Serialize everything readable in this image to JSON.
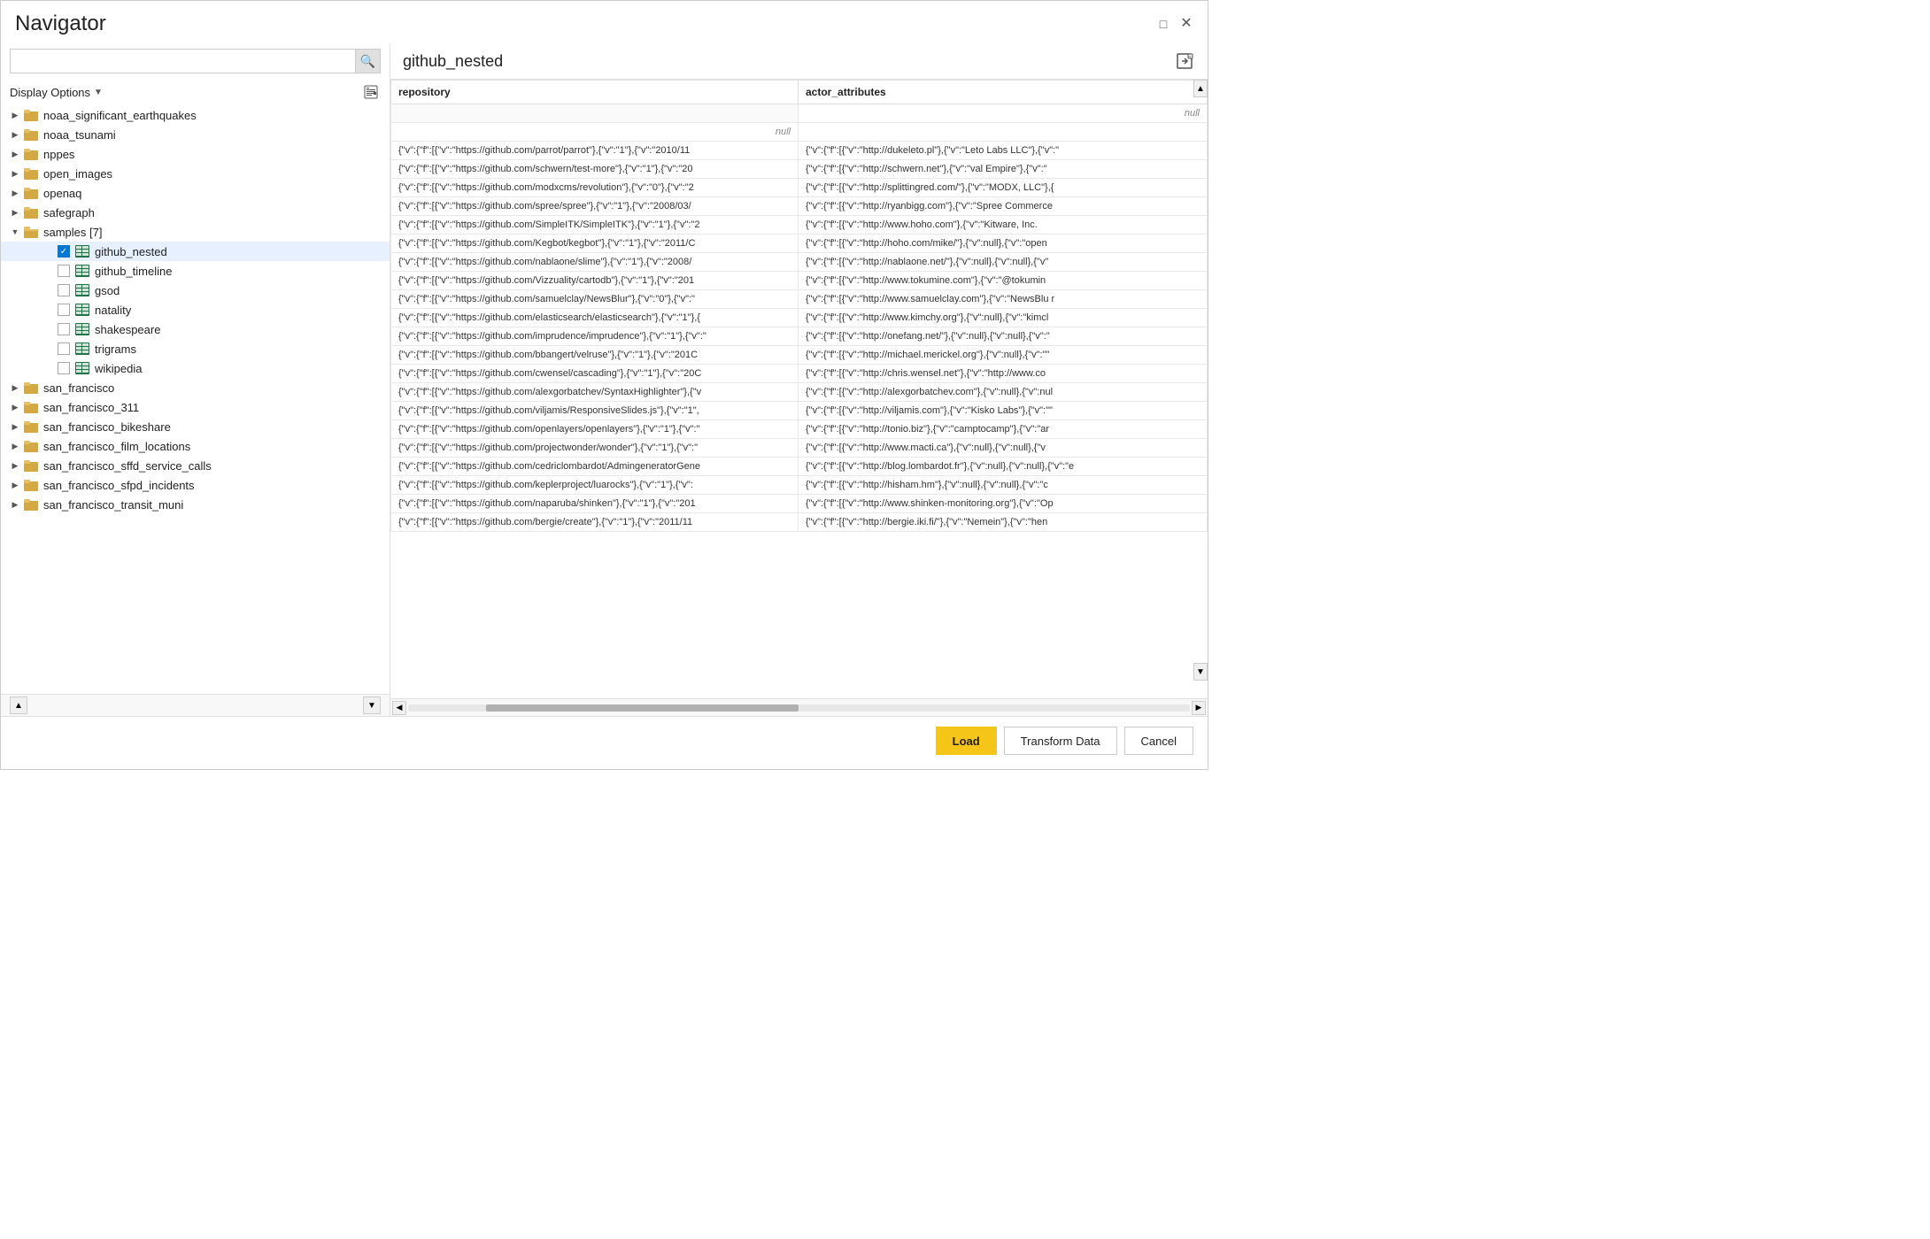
{
  "window": {
    "title": "Navigator"
  },
  "windowControls": {
    "minimize": "🗖",
    "close": "✕"
  },
  "leftPanel": {
    "searchPlaceholder": "",
    "displayOptions": "Display Options",
    "treeItems": [
      {
        "id": "noaa_significant_earthquakes",
        "label": "noaa_significant_earthquakes",
        "level": 1,
        "type": "folder",
        "state": "collapsed"
      },
      {
        "id": "noaa_tsunami",
        "label": "noaa_tsunami",
        "level": 1,
        "type": "folder",
        "state": "collapsed"
      },
      {
        "id": "nppes",
        "label": "nppes",
        "level": 1,
        "type": "folder",
        "state": "collapsed"
      },
      {
        "id": "open_images",
        "label": "open_images",
        "level": 1,
        "type": "folder",
        "state": "collapsed"
      },
      {
        "id": "openaq",
        "label": "openaq",
        "level": 1,
        "type": "folder",
        "state": "collapsed"
      },
      {
        "id": "safegraph",
        "label": "safegraph",
        "level": 1,
        "type": "folder",
        "state": "collapsed"
      },
      {
        "id": "samples",
        "label": "samples [7]",
        "level": 1,
        "type": "folder",
        "state": "expanded"
      },
      {
        "id": "github_nested",
        "label": "github_nested",
        "level": 2,
        "type": "table",
        "checked": true,
        "selected": true
      },
      {
        "id": "github_timeline",
        "label": "github_timeline",
        "level": 2,
        "type": "table",
        "checked": false
      },
      {
        "id": "gsod",
        "label": "gsod",
        "level": 2,
        "type": "table",
        "checked": false
      },
      {
        "id": "natality",
        "label": "natality",
        "level": 2,
        "type": "table",
        "checked": false
      },
      {
        "id": "shakespeare",
        "label": "shakespeare",
        "level": 2,
        "type": "table",
        "checked": false
      },
      {
        "id": "trigrams",
        "label": "trigrams",
        "level": 2,
        "type": "table",
        "checked": false
      },
      {
        "id": "wikipedia",
        "label": "wikipedia",
        "level": 2,
        "type": "table",
        "checked": false
      },
      {
        "id": "san_francisco",
        "label": "san_francisco",
        "level": 1,
        "type": "folder",
        "state": "collapsed"
      },
      {
        "id": "san_francisco_311",
        "label": "san_francisco_311",
        "level": 1,
        "type": "folder",
        "state": "collapsed"
      },
      {
        "id": "san_francisco_bikeshare",
        "label": "san_francisco_bikeshare",
        "level": 1,
        "type": "folder",
        "state": "collapsed"
      },
      {
        "id": "san_francisco_film_locations",
        "label": "san_francisco_film_locations",
        "level": 1,
        "type": "folder",
        "state": "collapsed"
      },
      {
        "id": "san_francisco_sffd_service_calls",
        "label": "san_francisco_sffd_service_calls",
        "level": 1,
        "type": "folder",
        "state": "collapsed"
      },
      {
        "id": "san_francisco_sfpd_incidents",
        "label": "san_francisco_sfpd_incidents",
        "level": 1,
        "type": "folder",
        "state": "collapsed"
      },
      {
        "id": "san_francisco_transit_muni",
        "label": "san_francisco_transit_muni",
        "level": 1,
        "type": "folder",
        "state": "collapsed"
      }
    ]
  },
  "rightPanel": {
    "title": "github_nested",
    "columns": [
      "repository",
      "actor_attributes"
    ],
    "rows": [
      {
        "repository": "",
        "actor_attributes": "",
        "null1": true,
        "null2": true
      },
      {
        "repository": "null",
        "actor_attributes": ""
      },
      {
        "repository": "{\"v\":{\"f\":[{\"v\":\"https://github.com/parrot/parrot\"},{\"v\":\"1\"},{\"v\":\"2010/11",
        "actor_attributes": "{\"v\":{\"f\":[{\"v\":\"http://dukeleto.pl\"},{\"v\":\"Leto Labs LLC\"},{\"v\":\""
      },
      {
        "repository": "{\"v\":{\"f\":[{\"v\":\"https://github.com/schwern/test-more\"},{\"v\":\"1\"},{\"v\":\"20",
        "actor_attributes": "{\"v\":{\"f\":[{\"v\":\"http://schwern.net\"},{\"v\":\"val Empire\"},{\"v\":\""
      },
      {
        "repository": "{\"v\":{\"f\":[{\"v\":\"https://github.com/modxcms/revolution\"},{\"v\":\"0\"},{\"v\":\"2",
        "actor_attributes": "{\"v\":{\"f\":[{\"v\":\"http://splittingred.com/\"},{\"v\":\"MODX, LLC\"},{"
      },
      {
        "repository": "{\"v\":{\"f\":[{\"v\":\"https://github.com/spree/spree\"},{\"v\":\"1\"},{\"v\":\"2008/03/",
        "actor_attributes": "{\"v\":{\"f\":[{\"v\":\"http://ryanbigg.com\"},{\"v\":\"Spree Commerce"
      },
      {
        "repository": "{\"v\":{\"f\":[{\"v\":\"https://github.com/SimpleITK/SimpleITK\"},{\"v\":\"1\"},{\"v\":\"2",
        "actor_attributes": "{\"v\":{\"f\":[{\"v\":\"http://www.hoho.com\"},{\"v\":\"Kitware, Inc."
      },
      {
        "repository": "{\"v\":{\"f\":[{\"v\":\"https://github.com/Kegbot/kegbot\"},{\"v\":\"1\"},{\"v\":\"2011/C",
        "actor_attributes": "{\"v\":{\"f\":[{\"v\":\"http://hoho.com/mike/\"},{\"v\":null},{\"v\":\"open"
      },
      {
        "repository": "{\"v\":{\"f\":[{\"v\":\"https://github.com/nablaone/slime\"},{\"v\":\"1\"},{\"v\":\"2008/",
        "actor_attributes": "{\"v\":{\"f\":[{\"v\":\"http://nablaone.net/\"},{\"v\":null},{\"v\":null},{\"v\""
      },
      {
        "repository": "{\"v\":{\"f\":[{\"v\":\"https://github.com/Vizzuality/cartodb\"},{\"v\":\"1\"},{\"v\":\"201",
        "actor_attributes": "{\"v\":{\"f\":[{\"v\":\"http://www.tokumine.com\"},{\"v\":\"@tokumin"
      },
      {
        "repository": "{\"v\":{\"f\":[{\"v\":\"https://github.com/samuelclay/NewsBlur\"},{\"v\":\"0\"},{\"v\":\"",
        "actor_attributes": "{\"v\":{\"f\":[{\"v\":\"http://www.samuelclay.com\"},{\"v\":\"NewsBlu r"
      },
      {
        "repository": "{\"v\":{\"f\":[{\"v\":\"https://github.com/elasticsearch/elasticsearch\"},{\"v\":\"1\"},{",
        "actor_attributes": "{\"v\":{\"f\":[{\"v\":\"http://www.kimchy.org\"},{\"v\":null},{\"v\":\"kimcl"
      },
      {
        "repository": "{\"v\":{\"f\":[{\"v\":\"https://github.com/imprudence/imprudence\"},{\"v\":\"1\"},{\"v\":\"",
        "actor_attributes": "{\"v\":{\"f\":[{\"v\":\"http://onefang.net/\"},{\"v\":null},{\"v\":null},{\"v\":\""
      },
      {
        "repository": "{\"v\":{\"f\":[{\"v\":\"https://github.com/bbangert/velruse\"},{\"v\":\"1\"},{\"v\":\"201C",
        "actor_attributes": "{\"v\":{\"f\":[{\"v\":\"http://michael.merickel.org\"},{\"v\":null},{\"v\":\"\""
      },
      {
        "repository": "{\"v\":{\"f\":[{\"v\":\"https://github.com/cwensel/cascading\"},{\"v\":\"1\"},{\"v\":\"20C",
        "actor_attributes": "{\"v\":{\"f\":[{\"v\":\"http://chris.wensel.net\"},{\"v\":\"http://www.co"
      },
      {
        "repository": "{\"v\":{\"f\":[{\"v\":\"https://github.com/alexgorbatchev/SyntaxHighlighter\"},{\"v",
        "actor_attributes": "{\"v\":{\"f\":[{\"v\":\"http://alexgorbatchev.com\"},{\"v\":null},{\"v\":nul"
      },
      {
        "repository": "{\"v\":{\"f\":[{\"v\":\"https://github.com/viljamis/ResponsiveSlides.js\"},{\"v\":\"1\",",
        "actor_attributes": "{\"v\":{\"f\":[{\"v\":\"http://viljamis.com\"},{\"v\":\"Kisko Labs\"},{\"v\":\"\""
      },
      {
        "repository": "{\"v\":{\"f\":[{\"v\":\"https://github.com/openlayers/openlayers\"},{\"v\":\"1\"},{\"v\":\"",
        "actor_attributes": "{\"v\":{\"f\":[{\"v\":\"http://tonio.biz\"},{\"v\":\"camptocamp\"},{\"v\":\"ar"
      },
      {
        "repository": "{\"v\":{\"f\":[{\"v\":\"https://github.com/projectwonder/wonder\"},{\"v\":\"1\"},{\"v\":\"",
        "actor_attributes": "{\"v\":{\"f\":[{\"v\":\"http://www.macti.ca\"},{\"v\":null},{\"v\":null},{\"v"
      },
      {
        "repository": "{\"v\":{\"f\":[{\"v\":\"https://github.com/cedriclombardot/AdmingeneratorGene",
        "actor_attributes": "{\"v\":{\"f\":[{\"v\":\"http://blog.lombardot.fr\"},{\"v\":null},{\"v\":null},{\"v\":\"e"
      },
      {
        "repository": "{\"v\":{\"f\":[{\"v\":\"https://github.com/keplerproject/luarocks\"},{\"v\":\"1\"},{\"v\":",
        "actor_attributes": "{\"v\":{\"f\":[{\"v\":\"http://hisham.hm\"},{\"v\":null},{\"v\":null},{\"v\":\"c"
      },
      {
        "repository": "{\"v\":{\"f\":[{\"v\":\"https://github.com/naparuba/shinken\"},{\"v\":\"1\"},{\"v\":\"201",
        "actor_attributes": "{\"v\":{\"f\":[{\"v\":\"http://www.shinken-monitoring.org\"},{\"v\":\"Op"
      },
      {
        "repository": "{\"v\":{\"f\":[{\"v\":\"https://github.com/bergie/create\"},{\"v\":\"1\"},{\"v\":\"2011/11",
        "actor_attributes": "{\"v\":{\"f\":[{\"v\":\"http://bergie.iki.fi/\"},{\"v\":\"Nemein\"},{\"v\":\"hen"
      }
    ]
  },
  "footer": {
    "loadLabel": "Load",
    "transformDataLabel": "Transform Data",
    "cancelLabel": "Cancel"
  }
}
